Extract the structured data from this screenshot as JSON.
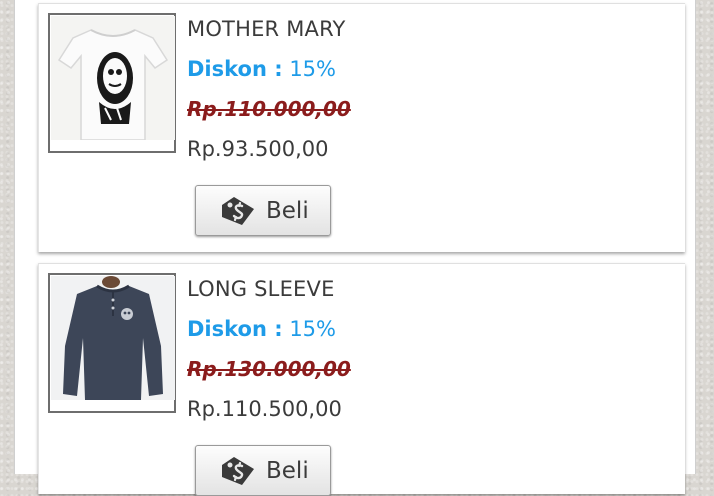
{
  "products": [
    {
      "name": "MOTHER MARY",
      "discount_label": "Diskon :",
      "discount_value": "15%",
      "old_price": "Rp.110.000,00",
      "new_price": "Rp.93.500,00",
      "buy_label": "Beli",
      "image_icon": "tshirt-white-skull-print"
    },
    {
      "name": "LONG SLEEVE",
      "discount_label": "Diskon :",
      "discount_value": "15%",
      "old_price": "Rp.130.000,00",
      "new_price": "Rp.110.500,00",
      "buy_label": "Beli",
      "image_icon": "longsleeve-navy-henley"
    }
  ],
  "colors": {
    "discount": "#1e9be8",
    "old_price": "#8b1c1c",
    "text": "#3b3b3b"
  },
  "icons": {
    "buy": "price-tag-dollar-icon"
  }
}
